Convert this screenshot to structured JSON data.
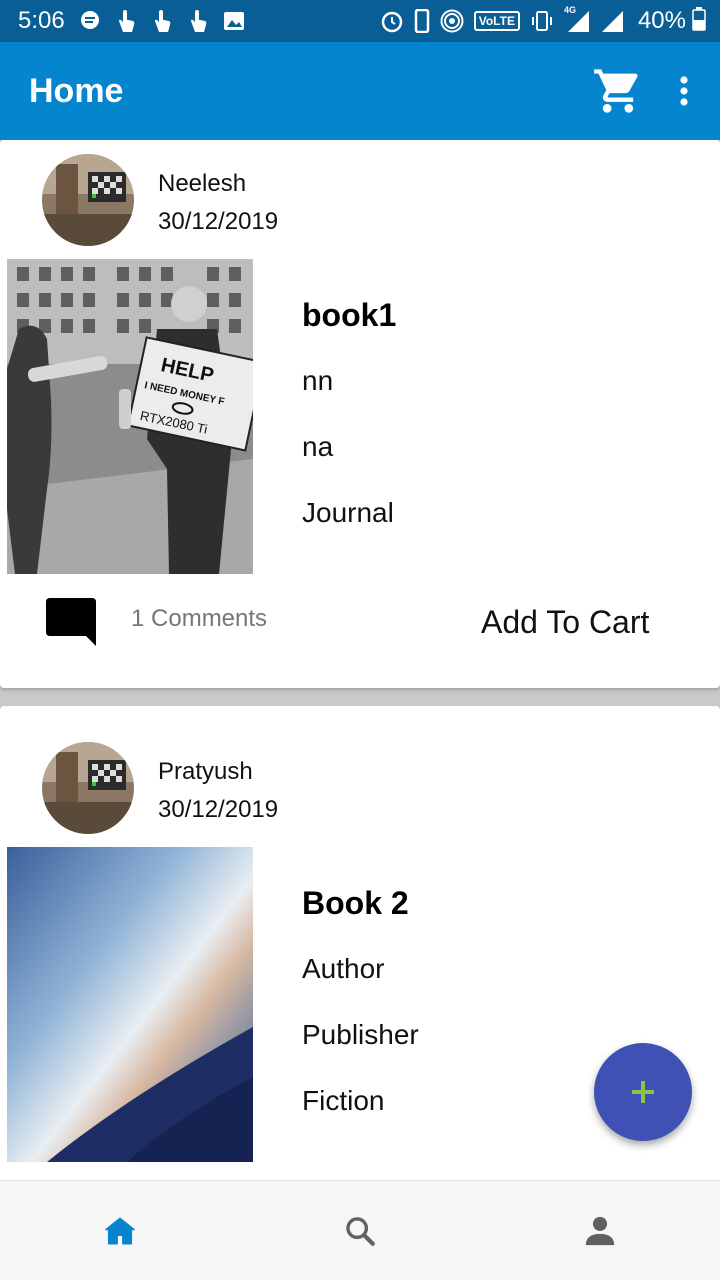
{
  "status_bar": {
    "time": "5:06",
    "network_badge": "VoLTE",
    "signal_badge": "4G",
    "battery": "40%"
  },
  "app_bar": {
    "title": "Home",
    "icons": [
      "shopping-cart-icon",
      "more-vert-icon"
    ]
  },
  "feed": {
    "posts": [
      {
        "user": "Neelesh",
        "date": "30/12/2019",
        "title": "book1",
        "author": "nn",
        "publisher": "na",
        "category": "Journal",
        "comments": "1 Comments",
        "cta": "Add To Cart"
      },
      {
        "user": "Pratyush",
        "date": "30/12/2019",
        "title": "Book 2",
        "author": "Author",
        "publisher": "Publisher",
        "category": "Fiction"
      }
    ]
  },
  "fab": {
    "icon": "plus-icon",
    "color": "#3f51b5",
    "glyph_color": "#8bc34a"
  },
  "bottom_nav": {
    "items": [
      {
        "icon": "home-icon",
        "active": true
      },
      {
        "icon": "search-icon",
        "active": false
      },
      {
        "icon": "person-icon",
        "active": false
      }
    ]
  },
  "colors": {
    "status_bar": "#0a5e96",
    "app_bar": "#0685cf",
    "active_nav": "#0685cf",
    "inactive_nav": "#616161"
  }
}
